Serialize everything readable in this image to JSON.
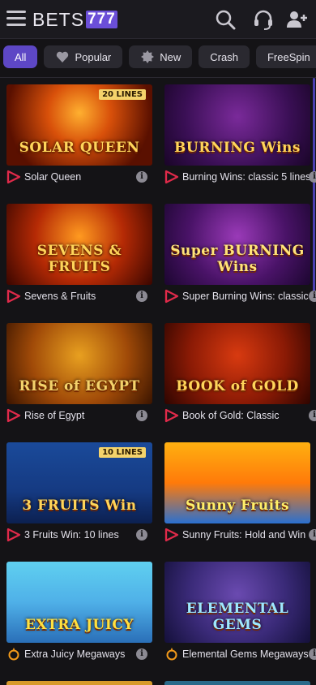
{
  "header": {
    "logo_text": "BETS",
    "logo_sevens": "777",
    "icons": [
      "menu-icon",
      "search-icon",
      "support-headset-icon",
      "add-user-icon"
    ]
  },
  "filters": [
    {
      "label": "All",
      "active": true,
      "icon": ""
    },
    {
      "label": "Popular",
      "active": false,
      "icon": "heart-icon"
    },
    {
      "label": "New",
      "active": false,
      "icon": "new-badge-icon"
    },
    {
      "label": "Crash",
      "active": false,
      "icon": ""
    },
    {
      "label": "FreeSpin",
      "active": false,
      "icon": ""
    }
  ],
  "games": [
    {
      "name": "Solar Queen",
      "art_title": "SOLAR QUEEN",
      "badge": "20 LINES",
      "provider": "playson"
    },
    {
      "name": "Burning Wins: classic 5 lines",
      "art_title": "BURNING Wins",
      "badge": "",
      "provider": "playson"
    },
    {
      "name": "Sevens & Fruits",
      "art_title": "SEVENS & FRUITS",
      "badge": "",
      "provider": "playson"
    },
    {
      "name": "Super Burning Wins: classic",
      "art_title": "Super BURNING Wins",
      "badge": "",
      "provider": "playson"
    },
    {
      "name": "Rise of Egypt",
      "art_title": "RISE of EGYPT",
      "badge": "",
      "provider": "playson"
    },
    {
      "name": "Book of Gold: Classic",
      "art_title": "BOOK of GOLD",
      "badge": "",
      "provider": "playson"
    },
    {
      "name": "3 Fruits Win: 10 lines",
      "art_title": "3 FRUITS Win",
      "badge": "10 LINES",
      "provider": "playson"
    },
    {
      "name": "Sunny Fruits: Hold and Win",
      "art_title": "Sunny Fruits",
      "badge": "",
      "provider": "playson"
    },
    {
      "name": "Extra Juicy Megaways",
      "art_title": "EXTRA JUICY",
      "badge": "",
      "provider": "pragmatic"
    },
    {
      "name": "Elemental Gems Megaways",
      "art_title": "ELEMENTAL GEMS",
      "badge": "",
      "provider": "pragmatic"
    }
  ]
}
